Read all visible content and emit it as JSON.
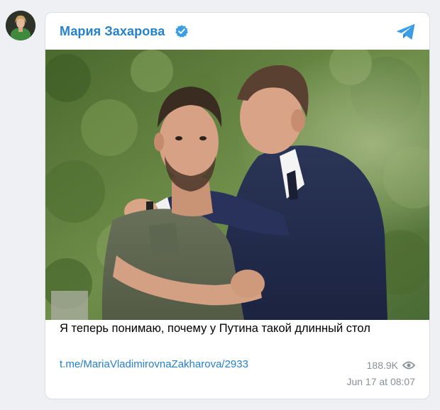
{
  "post": {
    "channel_name": "Мария Захарова",
    "verified": true,
    "caption": "Я теперь понимаю, почему у Путина такой длинный стол",
    "link": "t.me/MariaVladimirovnaZakharova/2933",
    "views": "188.9K",
    "date": "Jun 17 at 08:07"
  },
  "icons": {
    "verified": "verified-check-icon",
    "telegram": "telegram-plane-icon",
    "views": "eye-icon"
  },
  "colors": {
    "accent": "#2481cc",
    "verified": "#3a9de6",
    "meta": "#8a9096",
    "background": "#eef0f3"
  }
}
